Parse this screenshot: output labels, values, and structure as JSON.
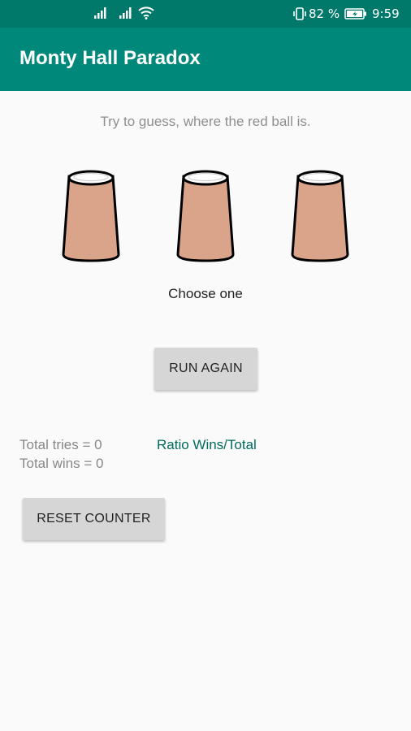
{
  "status_bar": {
    "battery_percent": "82 %",
    "time": "9:59",
    "icons": [
      "signal-icon",
      "signal-icon",
      "wifi-icon",
      "vibrate-icon",
      "battery-icon"
    ]
  },
  "app_bar": {
    "title": "Monty Hall Paradox",
    "color": "#00897b"
  },
  "game": {
    "hint": "Try to guess, where the red ball is.",
    "cups": [
      {
        "name": "cup-1",
        "color": "#d9a48a"
      },
      {
        "name": "cup-2",
        "color": "#d9a48a"
      },
      {
        "name": "cup-3",
        "color": "#d9a48a"
      }
    ],
    "choose_label": "Choose one",
    "run_again_label": "RUN AGAIN"
  },
  "stats": {
    "total_tries": "Total tries = 0",
    "total_wins": "Total wins = 0",
    "ratio_label": "Ratio Wins/Total",
    "ratio_color": "#006b5e"
  },
  "reset_label": "RESET COUNTER"
}
